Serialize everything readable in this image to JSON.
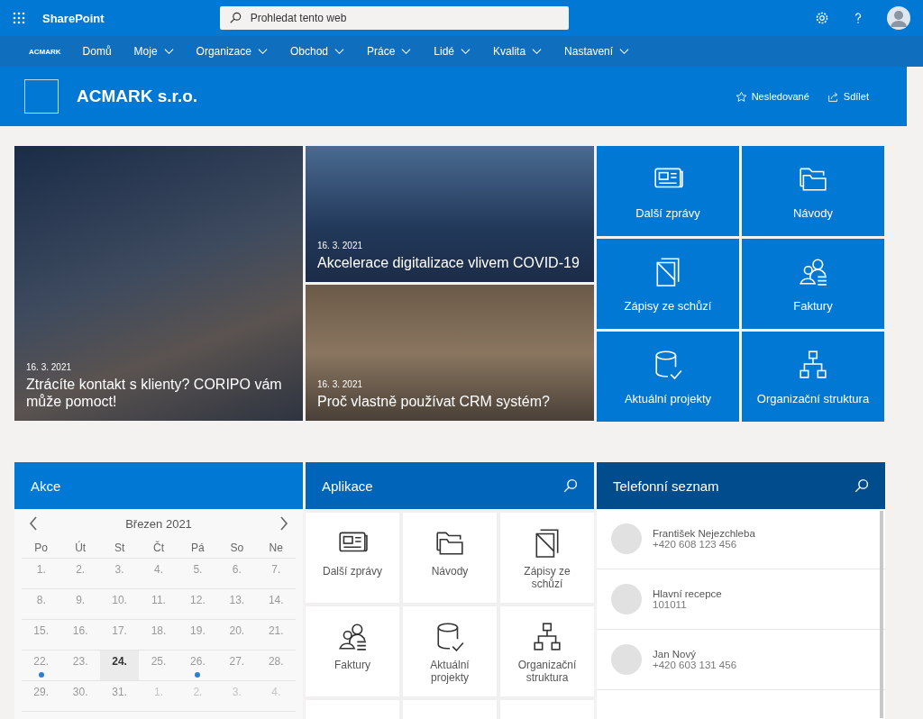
{
  "suite_bar": {
    "app_name": "SharePoint",
    "search": {
      "placeholder": "Prohledat tento web"
    }
  },
  "nav": {
    "logo": "ACMARK",
    "items": [
      {
        "label": "Domů",
        "has_menu": false
      },
      {
        "label": "Moje",
        "has_menu": true
      },
      {
        "label": "Organizace",
        "has_menu": true
      },
      {
        "label": "Obchod",
        "has_menu": true
      },
      {
        "label": "Práce",
        "has_menu": true
      },
      {
        "label": "Lidé",
        "has_menu": true
      },
      {
        "label": "Kvalita",
        "has_menu": true
      },
      {
        "label": "Nastavení",
        "has_menu": true
      }
    ]
  },
  "site_header": {
    "title": "ACMARK s.r.o.",
    "follow": "Nesledované",
    "share": "Sdílet"
  },
  "news": [
    {
      "date": "16. 3. 2021",
      "title": "Ztrácíte kontakt s klienty? CORIPO vám může pomoct!"
    },
    {
      "date": "16. 3. 2021",
      "title": "Akcelerace digitalizace vlivem COVID-19"
    },
    {
      "date": "16. 3. 2021",
      "title": "Proč vlastně používat CRM systém?"
    }
  ],
  "quick_links": [
    {
      "label": "Další zprávy",
      "kind": "news"
    },
    {
      "label": "Návody",
      "kind": "folder"
    },
    {
      "label": "Zápisy ze schůzí",
      "kind": "pages"
    },
    {
      "label": "Faktury",
      "kind": "people"
    },
    {
      "label": "Aktuální projekty",
      "kind": "database"
    },
    {
      "label": "Organizační struktura",
      "kind": "org"
    }
  ],
  "events": {
    "title": "Akce",
    "month": "Březen 2021",
    "weekdays": [
      "Po",
      "Út",
      "St",
      "Čt",
      "Pá",
      "So",
      "Ne"
    ],
    "weeks": [
      [
        {
          "day": "1.",
          "selected": false,
          "event": false,
          "outside": false
        },
        {
          "day": "2.",
          "selected": false,
          "event": false,
          "outside": false
        },
        {
          "day": "3.",
          "selected": false,
          "event": false,
          "outside": false
        },
        {
          "day": "4.",
          "selected": false,
          "event": false,
          "outside": false
        },
        {
          "day": "5.",
          "selected": false,
          "event": false,
          "outside": false
        },
        {
          "day": "6.",
          "selected": false,
          "event": false,
          "outside": false
        },
        {
          "day": "7.",
          "selected": false,
          "event": false,
          "outside": false
        }
      ],
      [
        {
          "day": "8.",
          "selected": false,
          "event": false,
          "outside": false
        },
        {
          "day": "9.",
          "selected": false,
          "event": false,
          "outside": false
        },
        {
          "day": "10.",
          "selected": false,
          "event": false,
          "outside": false
        },
        {
          "day": "11.",
          "selected": false,
          "event": false,
          "outside": false
        },
        {
          "day": "12.",
          "selected": false,
          "event": false,
          "outside": false
        },
        {
          "day": "13.",
          "selected": false,
          "event": false,
          "outside": false
        },
        {
          "day": "14.",
          "selected": false,
          "event": false,
          "outside": false
        }
      ],
      [
        {
          "day": "15.",
          "selected": false,
          "event": false,
          "outside": false
        },
        {
          "day": "16.",
          "selected": false,
          "event": false,
          "outside": false
        },
        {
          "day": "17.",
          "selected": false,
          "event": false,
          "outside": false
        },
        {
          "day": "18.",
          "selected": false,
          "event": false,
          "outside": false
        },
        {
          "day": "19.",
          "selected": false,
          "event": false,
          "outside": false
        },
        {
          "day": "20.",
          "selected": false,
          "event": false,
          "outside": false
        },
        {
          "day": "21.",
          "selected": false,
          "event": false,
          "outside": false
        }
      ],
      [
        {
          "day": "22.",
          "selected": false,
          "event": true,
          "outside": false
        },
        {
          "day": "23.",
          "selected": false,
          "event": false,
          "outside": false
        },
        {
          "day": "24.",
          "selected": true,
          "event": false,
          "outside": false
        },
        {
          "day": "25.",
          "selected": false,
          "event": false,
          "outside": false
        },
        {
          "day": "26.",
          "selected": false,
          "event": true,
          "outside": false
        },
        {
          "day": "27.",
          "selected": false,
          "event": false,
          "outside": false
        },
        {
          "day": "28.",
          "selected": false,
          "event": false,
          "outside": false
        }
      ],
      [
        {
          "day": "29.",
          "selected": false,
          "event": false,
          "outside": false
        },
        {
          "day": "30.",
          "selected": false,
          "event": false,
          "outside": false
        },
        {
          "day": "31.",
          "selected": false,
          "event": false,
          "outside": false
        },
        {
          "day": "1.",
          "selected": false,
          "event": false,
          "outside": true
        },
        {
          "day": "2.",
          "selected": false,
          "event": false,
          "outside": true
        },
        {
          "day": "3.",
          "selected": false,
          "event": false,
          "outside": true
        },
        {
          "day": "4.",
          "selected": false,
          "event": false,
          "outside": true
        }
      ]
    ]
  },
  "apps": {
    "title": "Aplikace",
    "items": [
      {
        "label": "Další zprávy",
        "kind": "news"
      },
      {
        "label": "Návody",
        "kind": "folder"
      },
      {
        "label": "Zápisy ze schůzí",
        "kind": "pages"
      },
      {
        "label": "Faktury",
        "kind": "people"
      },
      {
        "label": "Aktuální projekty",
        "kind": "database"
      },
      {
        "label": "Organizační struktura",
        "kind": "org"
      }
    ]
  },
  "phone_list": {
    "title": "Telefonní seznam",
    "contacts": [
      {
        "name": "František Nejezchleba",
        "phone": "+420 608 123 456"
      },
      {
        "name": "Hlavní recepce",
        "phone": "101011"
      },
      {
        "name": "Jan Nový",
        "phone": "+420 603 131 456"
      }
    ]
  }
}
